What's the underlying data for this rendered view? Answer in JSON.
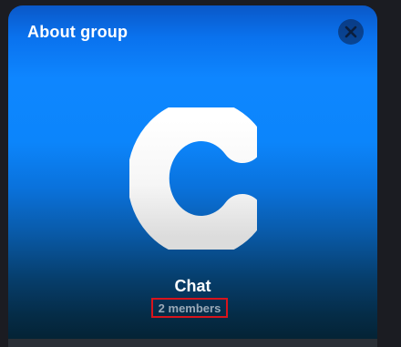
{
  "header": {
    "title": "About group",
    "close_icon": "close-icon"
  },
  "group": {
    "logo_icon": "chat-c-logo",
    "name": "Chat",
    "members": "2 members"
  },
  "colors": {
    "accent_blue": "#0e86ff",
    "highlight_border": "#d8141c"
  }
}
